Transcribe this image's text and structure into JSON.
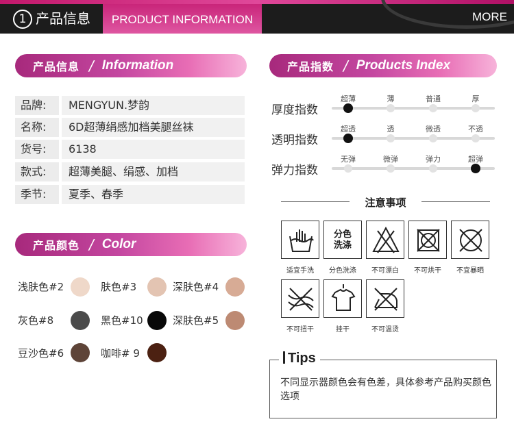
{
  "header": {
    "number": "1",
    "title_cn": "产品信息",
    "title_en": "PRODUCT INFORMATION",
    "more": "MORE"
  },
  "info_section": {
    "heading_cn": "产品信息",
    "slash": "/",
    "heading_en": "Information",
    "rows": [
      {
        "label": "品牌:",
        "value": "MENGYUN.梦韵"
      },
      {
        "label": "名称:",
        "value": "6D超薄绢感加档美腿丝袜"
      },
      {
        "label": "货号:",
        "value": "6138"
      },
      {
        "label": "款式:",
        "value": "超薄美腿、绢感、加档"
      },
      {
        "label": "季节:",
        "value": "夏季、春季"
      }
    ]
  },
  "color_section": {
    "heading_cn": "产品颜色",
    "slash": "/",
    "heading_en": "Color",
    "swatches": [
      {
        "name": "浅肤色#2",
        "color": "#efd8c9"
      },
      {
        "name": "肤色#3",
        "color": "#e3c4b2"
      },
      {
        "name": "深肤色#4",
        "color": "#d7ab95"
      },
      {
        "name": "灰色#8",
        "color": "#4b4b4b"
      },
      {
        "name": "黑色#10",
        "color": "#080808"
      },
      {
        "name": "深肤色#5",
        "color": "#bd8a73"
      },
      {
        "name": "豆沙色#6",
        "color": "#5e4438"
      },
      {
        "name": "咖啡# 9",
        "color": "#4c2112"
      }
    ]
  },
  "index_section": {
    "heading_cn": "产品指数",
    "slash": "/",
    "heading_en": "Products Index",
    "rows": [
      {
        "title": "厚度指数",
        "ticks": [
          "超薄",
          "薄",
          "普通",
          "厚"
        ],
        "selected": 0
      },
      {
        "title": "透明指数",
        "ticks": [
          "超透",
          "透",
          "微透",
          "不透"
        ],
        "selected": 0
      },
      {
        "title": "弹力指数",
        "ticks": [
          "无弹",
          "微弹",
          "弹力",
          "超弹"
        ],
        "selected": 3
      }
    ]
  },
  "care": {
    "title": "注意事项",
    "items": [
      {
        "caption": "适宜手洗",
        "icon": "hand-wash-icon"
      },
      {
        "caption": "分色洗涤",
        "icon": "separate-wash-icon",
        "label_top": "分色",
        "label_bottom": "洗涤"
      },
      {
        "caption": "不可漂白",
        "icon": "no-bleach-icon"
      },
      {
        "caption": "不可烘干",
        "icon": "no-tumble-dry-icon"
      },
      {
        "caption": "不宜暴晒",
        "icon": "no-sun-dry-icon"
      },
      {
        "caption": "不可扭干",
        "icon": "no-wring-icon"
      },
      {
        "caption": "挂干",
        "icon": "hang-dry-icon"
      },
      {
        "caption": "不可温烫",
        "icon": "no-iron-icon"
      }
    ]
  },
  "tips": {
    "title": "Tips",
    "text": "不同显示器颜色会有色差，具体参考产品购买颜色选项"
  },
  "colors": {
    "accent_pink": "#c9257a",
    "header_dark": "#1c1c1c"
  }
}
